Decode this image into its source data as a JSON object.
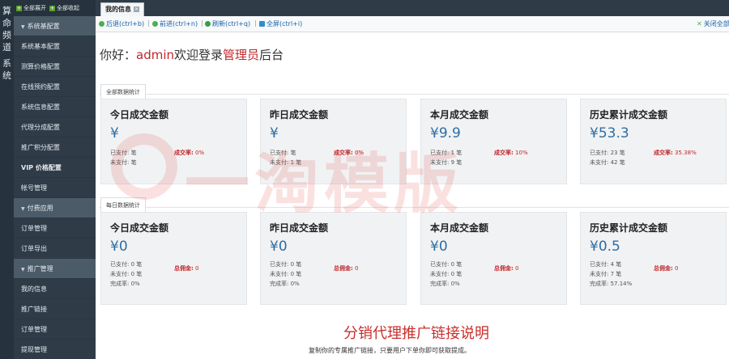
{
  "vertical_title": [
    "算",
    "命",
    "频",
    "道",
    "系",
    "统"
  ],
  "sidebar": {
    "expand_all": "全部展开",
    "collapse_all": "全部收起",
    "items": [
      {
        "label": "系统基配置",
        "type": "group"
      },
      {
        "label": "系统基本配置",
        "type": "item"
      },
      {
        "label": "测算价格配置",
        "type": "item"
      },
      {
        "label": "在线预约配置",
        "type": "item"
      },
      {
        "label": "系统信息配置",
        "type": "item"
      },
      {
        "label": "代理分成配置",
        "type": "item"
      },
      {
        "label": "推广积分配置",
        "type": "item"
      },
      {
        "label": "VIP 价格配置",
        "type": "item"
      },
      {
        "label": "帐号管理",
        "type": "item"
      },
      {
        "label": "付费应用",
        "type": "group"
      },
      {
        "label": "订单管理",
        "type": "item"
      },
      {
        "label": "订单导出",
        "type": "item"
      },
      {
        "label": "推广管理",
        "type": "group"
      },
      {
        "label": "我的信息",
        "type": "item"
      },
      {
        "label": "推广链接",
        "type": "item"
      },
      {
        "label": "订单管理",
        "type": "item"
      },
      {
        "label": "提现管理",
        "type": "item"
      }
    ]
  },
  "tabs": [
    {
      "label": "我的信息"
    }
  ],
  "toolbar": {
    "back": "后退(ctrl+b)",
    "forward": "前进(ctrl+n)",
    "refresh": "刷新(ctrl+q)",
    "fullscreen": "全屏(ctrl+i)",
    "close_all": "关闭全部"
  },
  "welcome": {
    "prefix": "你好：",
    "user": "admin",
    "mid": "欢迎登录",
    "role": "管理员",
    "suffix": "后台"
  },
  "all_stats": {
    "tag": "全部数据统计",
    "cards": [
      {
        "title": "今日成交金额",
        "amount": "¥",
        "paid": "已支付: 笔",
        "unpaid": "未支付: 笔",
        "rate_label": "成交率:",
        "rate_value": "0%"
      },
      {
        "title": "昨日成交金额",
        "amount": "¥",
        "paid": "已支付: 笔",
        "unpaid": "未支付: 1 笔",
        "rate_label": "成交率:",
        "rate_value": "0%"
      },
      {
        "title": "本月成交金额",
        "amount": "¥9.9",
        "paid": "已支付: 1 笔",
        "unpaid": "未支付: 9 笔",
        "rate_label": "成交率:",
        "rate_value": "10%"
      },
      {
        "title": "历史累计成交金额",
        "amount": "¥53.3",
        "paid": "已支付: 23 笔",
        "unpaid": "未支付: 42 笔",
        "rate_label": "成交率:",
        "rate_value": "35.38%"
      }
    ]
  },
  "daily_stats": {
    "tag": "每日数据统计",
    "cards": [
      {
        "title": "今日成交金额",
        "amount": "¥0",
        "paid": "已支付: 0 笔",
        "unpaid": "未支付: 0 笔",
        "completion": "完成率: 0%",
        "commission_label": "总佣金:",
        "commission_value": "0"
      },
      {
        "title": "昨日成交金额",
        "amount": "¥0",
        "paid": "已支付: 0 笔",
        "unpaid": "未支付: 0 笔",
        "completion": "完成率: 0%",
        "commission_label": "总佣金:",
        "commission_value": "0"
      },
      {
        "title": "本月成交金额",
        "amount": "¥0",
        "paid": "已支付: 0 笔",
        "unpaid": "未支付: 0 笔",
        "completion": "完成率: 0%",
        "commission_label": "总佣金:",
        "commission_value": "0"
      },
      {
        "title": "历史累计成交金额",
        "amount": "¥0.5",
        "paid": "已支付: 4 笔",
        "unpaid": "未支付: 7 笔",
        "completion": "完成率: 57.14%",
        "commission_label": "总佣金:",
        "commission_value": "0"
      }
    ]
  },
  "watermark": "一淘模版",
  "footer": {
    "title": "分销代理推广链接说明",
    "subtitle": "复制你的专属推广链接，只要用户下单你即可获取提成。"
  },
  "colors": {
    "sidebar_bg": "#2f3c48",
    "accent_red": "#c0262b",
    "amount_blue": "#2e6da4",
    "link_blue": "#1b61a6"
  }
}
